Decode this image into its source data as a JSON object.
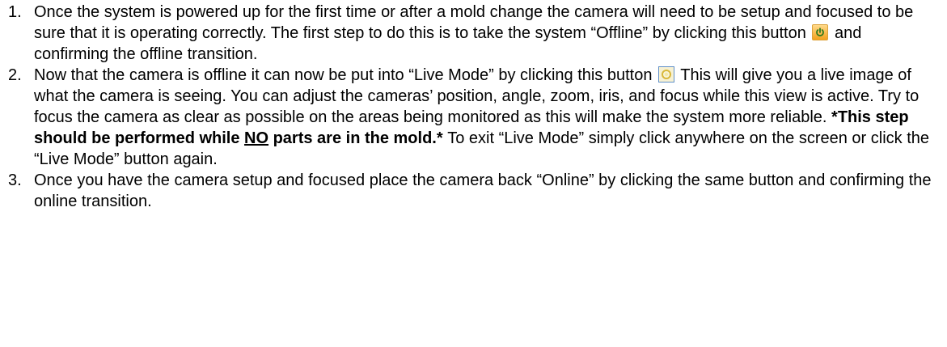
{
  "steps": [
    {
      "number": "1.",
      "text_before": "Once the system is powered up for the first time or after a mold change the camera will need to be setup and focused to be sure that it is operating correctly. The first step to do this is to take the system “Offline” by clicking this button",
      "icon": "power-icon",
      "text_after": " and confirming the offline transition."
    },
    {
      "number": "2.",
      "text_before": "Now that the camera is offline it can now be put into “Live Mode” by clicking this button",
      "icon": "live-mode-icon",
      "text_after": " This will give you a live image of what the camera is seeing. You can adjust the cameras’ position, angle, zoom, iris, and focus while this view is active. Try to focus the camera as clear as possible on the areas being monitored as this will make the system more reliable. ",
      "bold_before": "*This step should be performed while ",
      "bold_underline": "NO",
      "bold_after": " parts are in the mold.*",
      "text_end": " To exit “Live Mode” simply click anywhere on the screen or click the “Live Mode” button again."
    },
    {
      "number": "3.",
      "text": "Once you have the camera setup and focused place the camera back “Online” by clicking the same button and confirming the online transition."
    }
  ],
  "colors": {
    "offline_button": "#f3a11d",
    "live_button_border": "#5f8fc9",
    "live_button_fill": "#f7f1d3"
  }
}
